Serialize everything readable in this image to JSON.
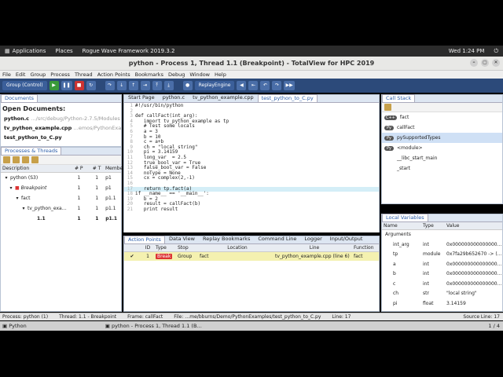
{
  "topbar": {
    "applications": "Applications",
    "places": "Places",
    "app_name": "Rogue Wave Framework 2019.3.2",
    "clock": "Wed  1:24 PM"
  },
  "window": {
    "title": "python - Process 1, Thread 1.1 (Breakpoint) - TotalView for HPC 2019"
  },
  "menu": [
    "File",
    "Edit",
    "Group",
    "Process",
    "Thread",
    "Action Points",
    "Bookmarks",
    "Debug",
    "Window",
    "Help"
  ],
  "toolbar": {
    "group_control": "Group (Control)",
    "replay_engine": "ReplayEngine"
  },
  "documents": {
    "tab": "Documents",
    "heading": "Open Documents:",
    "items": [
      {
        "name": "python.c",
        "path": "…/src/debug/Python-2.7.5/Modules"
      },
      {
        "name": "tv_python_example.cpp",
        "path": "…emos/PythonExamples"
      },
      {
        "name": "test_python_to_C.py",
        "path": ""
      }
    ]
  },
  "processes": {
    "tab": "Processes & Threads",
    "headers": [
      "Description",
      "# P",
      "# T",
      "Membe"
    ],
    "rows": [
      {
        "desc": "python (S3)",
        "p": "1",
        "t": "1",
        "m": "p1"
      },
      {
        "desc": "Breakpoint",
        "p": "1",
        "t": "1",
        "m": "p1"
      },
      {
        "desc": "fact",
        "p": "1",
        "t": "1",
        "m": "p1.1"
      },
      {
        "desc": "tv_python_exa…",
        "p": "1",
        "t": "1",
        "m": "p1.1"
      },
      {
        "desc": "1.1",
        "p": "1",
        "t": "1",
        "m": "p1.1"
      }
    ]
  },
  "source": {
    "tabs": [
      "Start Page",
      "python.c",
      "tv_python_example.cpp",
      "test_python_to_C.py"
    ],
    "active_tab": 3,
    "lines": [
      {
        "n": "1",
        "t": "#!/usr/bin/python"
      },
      {
        "n": "2",
        "t": ""
      },
      {
        "n": "3",
        "t": "def callFact(int_arg):"
      },
      {
        "n": "4",
        "t": "   import tv_python_example as tp"
      },
      {
        "n": "5",
        "t": "   # Test some locals"
      },
      {
        "n": "6",
        "t": "   a = 3"
      },
      {
        "n": "7",
        "t": "   b = 10"
      },
      {
        "n": "8",
        "t": "   c = a+b"
      },
      {
        "n": "9",
        "t": "   ch = \"local string\""
      },
      {
        "n": "10",
        "t": "   pi = 3.14159"
      },
      {
        "n": "11",
        "t": "   long_var  = 2.5"
      },
      {
        "n": "12",
        "t": "   true_bool_var = True"
      },
      {
        "n": "13",
        "t": "   false_bool_var = False"
      },
      {
        "n": "14",
        "t": "   noType = None"
      },
      {
        "n": "15",
        "t": "   cx = complex(2,-1)"
      },
      {
        "n": "16",
        "t": ""
      },
      {
        "n": "17",
        "t": "   return tp.fact(a)"
      },
      {
        "n": "18",
        "t": "if __name__ == '__main__':"
      },
      {
        "n": "19",
        "t": "   b = 2"
      },
      {
        "n": "20",
        "t": "   result = callFact(b)"
      },
      {
        "n": "21",
        "t": "   print result"
      }
    ],
    "highlight_line": 17
  },
  "action_points": {
    "tabs": [
      "Action Points",
      "Data View",
      "Replay Bookmarks",
      "Command Line",
      "Logger",
      "Input/Output"
    ],
    "headers": [
      "",
      "ID",
      "Type",
      "Stop",
      "Location",
      "Line",
      "Function"
    ],
    "rows": [
      {
        "check": "✔",
        "id": "1",
        "type": "Break",
        "stop": "Group",
        "location": "fact",
        "line": "tv_python_example.cpp (line 6)",
        "function": "fact"
      }
    ]
  },
  "call_stack": {
    "tab": "Call Stack",
    "frames": [
      {
        "badge": "C++",
        "name": "fact"
      },
      {
        "badge": "Py",
        "name": "callFact"
      },
      {
        "badge": "Py",
        "name": "pySupportedTypes"
      },
      {
        "badge": "Py",
        "name": "<module>"
      },
      {
        "badge": "",
        "name": "__libc_start_main"
      },
      {
        "badge": "",
        "name": "_start"
      }
    ],
    "selected": 2
  },
  "locals": {
    "tab": "Local Variables",
    "headers": [
      "Name",
      "Type",
      "Value"
    ],
    "rows": [
      {
        "name": "Arguments",
        "type": "",
        "value": ""
      },
      {
        "name": "int_arg",
        "type": "int",
        "value": "0x000000000000000…"
      },
      {
        "name": "tp",
        "type": "module",
        "value": "0x7fa29b652670 -> (…"
      },
      {
        "name": "a",
        "type": "int",
        "value": "0x000000000000000…"
      },
      {
        "name": "b",
        "type": "int",
        "value": "0x000000000000000…"
      },
      {
        "name": "c",
        "type": "int",
        "value": "0x000000000000000…"
      },
      {
        "name": "ch",
        "type": "str",
        "value": "\"local string\""
      },
      {
        "name": "pi",
        "type": "float",
        "value": "3.14159"
      }
    ]
  },
  "status": {
    "process": "Process: python (1)",
    "thread": "Thread: 1.1 - Breakpoint",
    "frame": "Frame: callFact",
    "file": "File: …me/bburns/Demo/PythonExamples/test_python_to_C.py",
    "line": "Line: 17",
    "source_line": "Source Line: 17"
  },
  "taskbar": {
    "item1": "Python",
    "item2": "python - Process 1, Thread 1.1 (B…",
    "pager": "1 / 4"
  }
}
